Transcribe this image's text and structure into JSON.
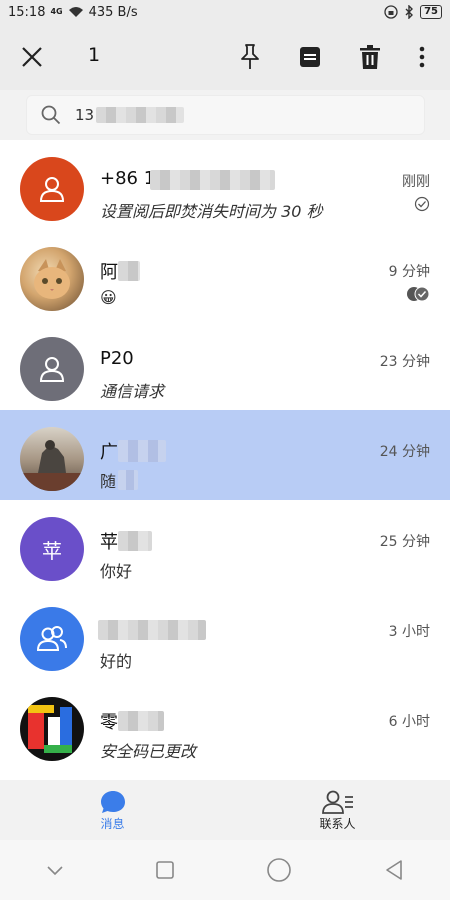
{
  "status": {
    "time": "15:18",
    "network": "4G",
    "speed": "435 B/s",
    "battery": "75"
  },
  "actionbar": {
    "selected_count": "1",
    "icons": [
      "close-icon",
      "pin-icon",
      "archive-icon",
      "delete-icon",
      "more-icon"
    ]
  },
  "search": {
    "query": "13"
  },
  "conversations": [
    {
      "title": "+86 1",
      "preview": "设置阅后即焚消失时间为 30 秒",
      "time": "刚刚",
      "avatar": "person-icon",
      "avatar_color": "#d9471c"
    },
    {
      "title": "阿",
      "preview": "😀",
      "time": "9 分钟",
      "avatar": "cat-photo",
      "avatar_color": "#c9a67a"
    },
    {
      "title": "P20",
      "preview": "通信请求",
      "time": "23 分钟",
      "avatar": "person-icon",
      "avatar_color": "#6e6e78"
    },
    {
      "title": "广",
      "preview": "随",
      "time": "24 分钟",
      "avatar": "statue-photo",
      "avatar_color": "#7b6a5c"
    },
    {
      "title": "苹",
      "preview": "你好",
      "time": "25 分钟",
      "avatar": "苹",
      "avatar_color": "#6a4fc9"
    },
    {
      "title": "",
      "preview": "好的",
      "time": "3 小时",
      "avatar": "group-icon",
      "avatar_color": "#3a7ae8"
    },
    {
      "title": "零",
      "preview": "安全码已更改",
      "time": "6 小时",
      "avatar": "colorful-logo",
      "avatar_color": "#111111"
    }
  ],
  "bottomnav": {
    "messages_label": "消息",
    "contacts_label": "联系人"
  },
  "colors": {
    "accent": "#3b7de9",
    "selected_row": "#b8ccf5"
  }
}
